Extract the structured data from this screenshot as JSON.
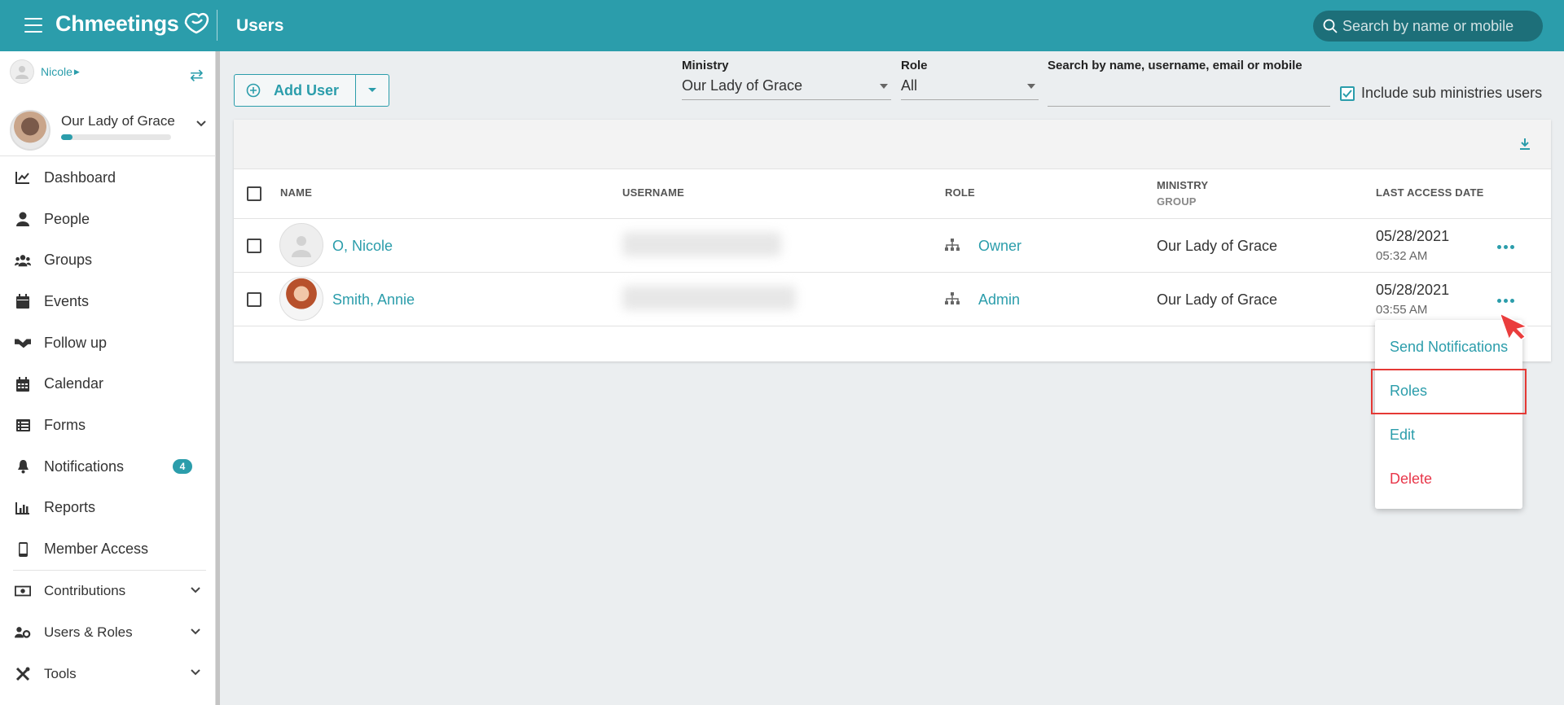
{
  "app": {
    "logo": "Chmeetings",
    "page_title": "Users",
    "search_placeholder": "Search by name or mobile"
  },
  "sidebar": {
    "user": "Nicole",
    "church": {
      "name": "Our Lady of Grace",
      "progress": 0.1
    },
    "items": [
      {
        "label": "Dashboard",
        "icon": "chart-line-icon"
      },
      {
        "label": "People",
        "icon": "person-icon"
      },
      {
        "label": "Groups",
        "icon": "users-icon"
      },
      {
        "label": "Events",
        "icon": "calendar-icon"
      },
      {
        "label": "Follow up",
        "icon": "handshake-icon"
      },
      {
        "label": "Calendar",
        "icon": "calendar-grid-icon"
      },
      {
        "label": "Forms",
        "icon": "list-icon"
      },
      {
        "label": "Notifications",
        "icon": "bell-icon",
        "badge": "4"
      },
      {
        "label": "Reports",
        "icon": "bar-chart-icon"
      },
      {
        "label": "Member Access",
        "icon": "mobile-icon"
      },
      {
        "label": "Contributions",
        "icon": "money-icon"
      },
      {
        "label": "Users & Roles",
        "icon": "users-cog-icon"
      },
      {
        "label": "Tools",
        "icon": "tools-icon"
      }
    ]
  },
  "toolbar": {
    "add_user": "Add User",
    "ministry_label": "Ministry",
    "ministry_value": "Our Lady of Grace",
    "role_label": "Role",
    "role_value": "All",
    "search_label": "Search by name, username, email or mobile",
    "include_sub": "Include sub ministries users"
  },
  "table": {
    "headers": {
      "name": "NAME",
      "username": "USERNAME",
      "role": "ROLE",
      "ministry": "MINISTRY",
      "group": "GROUP",
      "last_access": "LAST ACCESS DATE"
    },
    "rows": [
      {
        "name": "O, Nicole",
        "role": "Owner",
        "ministry": "Our Lady of Grace",
        "date": "05/28/2021",
        "time": "05:32 AM"
      },
      {
        "name": "Smith, Annie",
        "role": "Admin",
        "ministry": "Our Lady of Grace",
        "date": "05/28/2021",
        "time": "03:55 AM"
      }
    ]
  },
  "menu": {
    "items": [
      "Send Notifications",
      "Roles",
      "Edit",
      "Delete"
    ]
  },
  "colors": {
    "accent": "#2b9dab",
    "danger": "#e8374a",
    "highlight": "#e53935"
  }
}
